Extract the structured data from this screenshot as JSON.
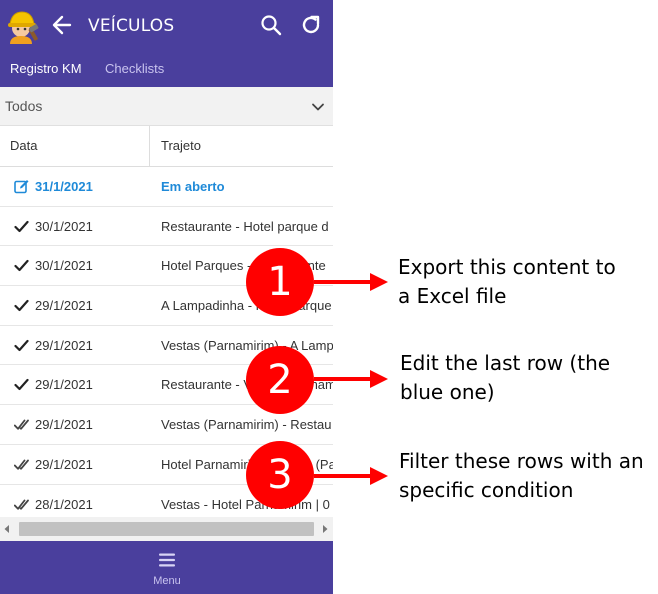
{
  "header": {
    "title": "VEÍCULOS",
    "logo_icon": "worker-helmet-logo-icon",
    "back_icon": "arrow-left-icon",
    "search_icon": "search-icon",
    "refresh_icon": "refresh-icon",
    "background": "#4a3f9d"
  },
  "tabs": [
    {
      "label": "Registro KM",
      "active": true
    },
    {
      "label": "Checklists",
      "active": false
    }
  ],
  "filter": {
    "value": "Todos",
    "icon": "chevron-down-icon"
  },
  "table": {
    "columns": [
      "Data",
      "Trajeto"
    ],
    "rows": [
      {
        "icon": "edit-icon",
        "date": "31/1/2021",
        "route": "Em aberto",
        "status": "open"
      },
      {
        "icon": "check-icon",
        "date": "30/1/2021",
        "route": "Restaurante - Hotel parque d",
        "status": "done"
      },
      {
        "icon": "check-icon",
        "date": "30/1/2021",
        "route": "Hotel Parques - Restaurante",
        "status": "done"
      },
      {
        "icon": "check-icon",
        "date": "29/1/2021",
        "route": "A Lampadinha - Hotel Parque",
        "status": "done"
      },
      {
        "icon": "check-icon",
        "date": "29/1/2021",
        "route": "Vestas (Parnamirim) - A Lamp",
        "status": "done"
      },
      {
        "icon": "check-icon",
        "date": "29/1/2021",
        "route": "Restaurante - Vestas (Parnamirim)",
        "status": "done"
      },
      {
        "icon": "double-check-icon",
        "date": "29/1/2021",
        "route": "Vestas (Parnamirim) - Restau",
        "status": "verified"
      },
      {
        "icon": "double-check-icon",
        "date": "29/1/2021",
        "route": "Hotel Parnamirim - Vestas (Pa",
        "status": "verified"
      },
      {
        "icon": "double-check-icon",
        "date": "28/1/2021",
        "route": "Vestas - Hotel Parnamirim | 0",
        "status": "verified"
      }
    ]
  },
  "bottom_nav": {
    "label": "Menu",
    "icon": "hamburger-menu-icon"
  },
  "annotations": [
    {
      "number": "1",
      "text_line1": "Export this content to",
      "text_line2": "a Excel file"
    },
    {
      "number": "2",
      "text_line1": "Edit the last row (the",
      "text_line2": "blue one)"
    },
    {
      "number": "3",
      "text_line1": "Filter these rows with an",
      "text_line2": "specific condition"
    }
  ],
  "colors": {
    "brand": "#4a3f9d",
    "accent_blue": "#1f8ad8",
    "callout_red": "#ff0000"
  }
}
